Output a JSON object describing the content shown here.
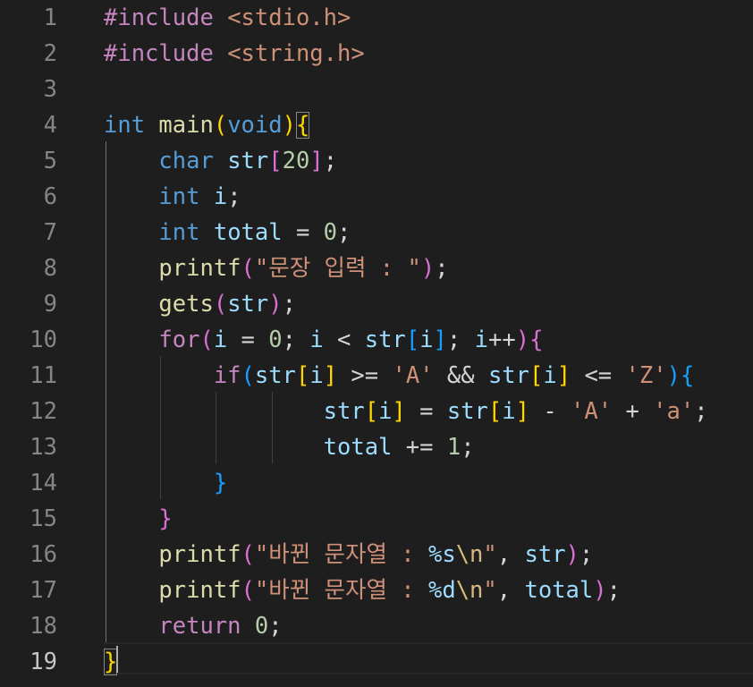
{
  "editor": {
    "language": "C",
    "theme_colors": {
      "background": "#1e1e1e",
      "line_number": "#858585",
      "keyword_type": "#569cd6",
      "keyword_control": "#c586c0",
      "function": "#dcdcaa",
      "variable": "#9cdcfe",
      "number": "#b5cea8",
      "string": "#ce9178",
      "escape": "#d7ba7d",
      "bracket_level_1": "#ffd700",
      "bracket_level_2": "#da70d6",
      "bracket_level_3": "#179fff"
    },
    "active_line": 19,
    "line_numbers": [
      "1",
      "2",
      "3",
      "4",
      "5",
      "6",
      "7",
      "8",
      "9",
      "10",
      "11",
      "12",
      "13",
      "14",
      "15",
      "16",
      "17",
      "18",
      "19"
    ],
    "lines": [
      {
        "indent": "",
        "tokens": [
          [
            "#include",
            "preproc"
          ],
          [
            " ",
            "punct"
          ],
          [
            "<stdio.h>",
            "include"
          ]
        ]
      },
      {
        "indent": "",
        "tokens": [
          [
            "#include",
            "preproc"
          ],
          [
            " ",
            "punct"
          ],
          [
            "<string.h>",
            "include"
          ]
        ]
      },
      {
        "indent": "",
        "tokens": []
      },
      {
        "indent": "",
        "tokens": [
          [
            "int",
            "type"
          ],
          [
            " ",
            "punct"
          ],
          [
            "main",
            "func"
          ],
          [
            "(",
            "b1"
          ],
          [
            "void",
            "type"
          ],
          [
            ")",
            "b1"
          ],
          [
            "{",
            "b1"
          ]
        ]
      },
      {
        "indent": "    ",
        "tokens": [
          [
            "char",
            "type"
          ],
          [
            " ",
            "punct"
          ],
          [
            "str",
            "var"
          ],
          [
            "[",
            "b2"
          ],
          [
            "20",
            "num"
          ],
          [
            "]",
            "b2"
          ],
          [
            ";",
            "punct"
          ]
        ]
      },
      {
        "indent": "    ",
        "tokens": [
          [
            "int",
            "type"
          ],
          [
            " ",
            "punct"
          ],
          [
            "i",
            "var"
          ],
          [
            ";",
            "punct"
          ]
        ]
      },
      {
        "indent": "    ",
        "tokens": [
          [
            "int",
            "type"
          ],
          [
            " ",
            "punct"
          ],
          [
            "total",
            "var"
          ],
          [
            " = ",
            "punct"
          ],
          [
            "0",
            "num"
          ],
          [
            ";",
            "punct"
          ]
        ]
      },
      {
        "indent": "    ",
        "tokens": [
          [
            "printf",
            "func"
          ],
          [
            "(",
            "b2"
          ],
          [
            "\"문장 입력 : \"",
            "str"
          ],
          [
            ")",
            "b2"
          ],
          [
            ";",
            "punct"
          ]
        ]
      },
      {
        "indent": "    ",
        "tokens": [
          [
            "gets",
            "func"
          ],
          [
            "(",
            "b2"
          ],
          [
            "str",
            "var"
          ],
          [
            ")",
            "b2"
          ],
          [
            ";",
            "punct"
          ]
        ]
      },
      {
        "indent": "    ",
        "tokens": [
          [
            "for",
            "ctrl"
          ],
          [
            "(",
            "b2"
          ],
          [
            "i",
            "var"
          ],
          [
            " = ",
            "punct"
          ],
          [
            "0",
            "num"
          ],
          [
            "; ",
            "punct"
          ],
          [
            "i",
            "var"
          ],
          [
            " < ",
            "punct"
          ],
          [
            "str",
            "var"
          ],
          [
            "[",
            "b3"
          ],
          [
            "i",
            "var"
          ],
          [
            "]",
            "b3"
          ],
          [
            "; ",
            "punct"
          ],
          [
            "i",
            "var"
          ],
          [
            "++",
            "punct"
          ],
          [
            ")",
            "b2"
          ],
          [
            "{",
            "b2"
          ]
        ]
      },
      {
        "indent": "        ",
        "tokens": [
          [
            "if",
            "ctrl"
          ],
          [
            "(",
            "b3"
          ],
          [
            "str",
            "var"
          ],
          [
            "[",
            "b1"
          ],
          [
            "i",
            "var"
          ],
          [
            "]",
            "b1"
          ],
          [
            " >= ",
            "punct"
          ],
          [
            "'A'",
            "str"
          ],
          [
            " && ",
            "punct"
          ],
          [
            "str",
            "var"
          ],
          [
            "[",
            "b1"
          ],
          [
            "i",
            "var"
          ],
          [
            "]",
            "b1"
          ],
          [
            " <= ",
            "punct"
          ],
          [
            "'Z'",
            "str"
          ],
          [
            ")",
            "b3"
          ],
          [
            "{",
            "b3"
          ]
        ]
      },
      {
        "indent": "                ",
        "tokens": [
          [
            "str",
            "var"
          ],
          [
            "[",
            "b1"
          ],
          [
            "i",
            "var"
          ],
          [
            "]",
            "b1"
          ],
          [
            " = ",
            "punct"
          ],
          [
            "str",
            "var"
          ],
          [
            "[",
            "b1"
          ],
          [
            "i",
            "var"
          ],
          [
            "]",
            "b1"
          ],
          [
            " - ",
            "punct"
          ],
          [
            "'A'",
            "str"
          ],
          [
            " + ",
            "punct"
          ],
          [
            "'a'",
            "str"
          ],
          [
            ";",
            "punct"
          ]
        ]
      },
      {
        "indent": "                ",
        "tokens": [
          [
            "total",
            "var"
          ],
          [
            " += ",
            "punct"
          ],
          [
            "1",
            "num"
          ],
          [
            ";",
            "punct"
          ]
        ]
      },
      {
        "indent": "        ",
        "tokens": [
          [
            "}",
            "b3"
          ]
        ]
      },
      {
        "indent": "    ",
        "tokens": [
          [
            "}",
            "b2"
          ]
        ]
      },
      {
        "indent": "    ",
        "tokens": [
          [
            "printf",
            "func"
          ],
          [
            "(",
            "b2"
          ],
          [
            "\"바뀐 문자열 : ",
            "str"
          ],
          [
            "%s",
            "fmt"
          ],
          [
            "\\n",
            "esc"
          ],
          [
            "\"",
            "str"
          ],
          [
            ", ",
            "punct"
          ],
          [
            "str",
            "var"
          ],
          [
            ")",
            "b2"
          ],
          [
            ";",
            "punct"
          ]
        ]
      },
      {
        "indent": "    ",
        "tokens": [
          [
            "printf",
            "func"
          ],
          [
            "(",
            "b2"
          ],
          [
            "\"바뀐 문자열 : ",
            "str"
          ],
          [
            "%d",
            "fmt"
          ],
          [
            "\\n",
            "esc"
          ],
          [
            "\"",
            "str"
          ],
          [
            ", ",
            "punct"
          ],
          [
            "total",
            "var"
          ],
          [
            ")",
            "b2"
          ],
          [
            ";",
            "punct"
          ]
        ]
      },
      {
        "indent": "    ",
        "tokens": [
          [
            "return",
            "ctrl"
          ],
          [
            " ",
            "punct"
          ],
          [
            "0",
            "num"
          ],
          [
            ";",
            "punct"
          ]
        ]
      },
      {
        "indent": "",
        "tokens": [
          [
            "}",
            "b1"
          ]
        ]
      }
    ]
  }
}
